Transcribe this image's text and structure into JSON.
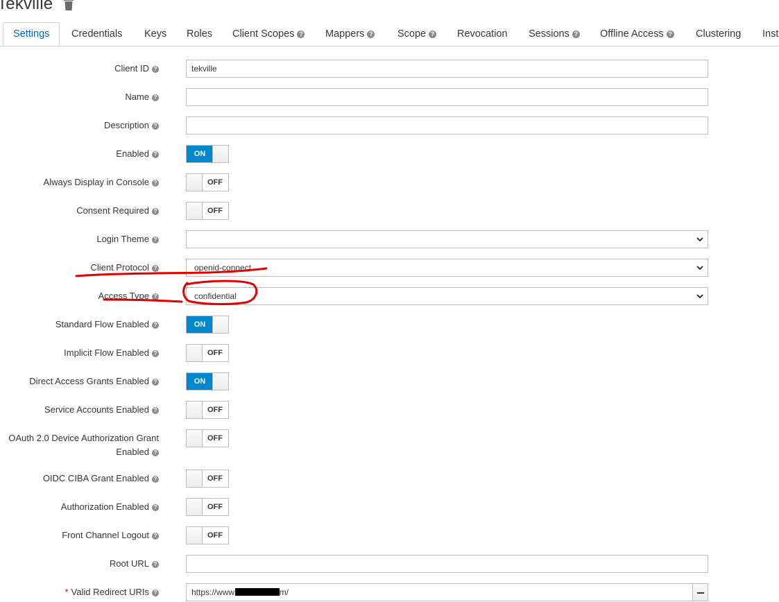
{
  "header": {
    "title": "Tekville",
    "delete_icon": "trash-icon"
  },
  "tabs": [
    {
      "label": "Settings",
      "help": false,
      "active": true
    },
    {
      "label": "Credentials",
      "help": false
    },
    {
      "label": "Keys",
      "help": false
    },
    {
      "label": "Roles",
      "help": false
    },
    {
      "label": "Client Scopes",
      "help": true
    },
    {
      "label": "Mappers",
      "help": true
    },
    {
      "label": "Scope",
      "help": true
    },
    {
      "label": "Revocation",
      "help": false
    },
    {
      "label": "Sessions",
      "help": true
    },
    {
      "label": "Offline Access",
      "help": true
    },
    {
      "label": "Clustering",
      "help": false
    },
    {
      "label": "Inst",
      "help": false
    }
  ],
  "form": {
    "client_id": {
      "label": "Client ID",
      "value": "tekville"
    },
    "name": {
      "label": "Name",
      "value": ""
    },
    "description": {
      "label": "Description",
      "value": ""
    },
    "enabled": {
      "label": "Enabled",
      "state": "ON"
    },
    "always_display": {
      "label": "Always Display in Console",
      "state": "OFF"
    },
    "consent_required": {
      "label": "Consent Required",
      "state": "OFF"
    },
    "login_theme": {
      "label": "Login Theme",
      "value": ""
    },
    "client_protocol": {
      "label": "Client Protocol",
      "value": "openid-connect"
    },
    "access_type": {
      "label": "Access Type",
      "value": "confidential"
    },
    "standard_flow": {
      "label": "Standard Flow Enabled",
      "state": "ON"
    },
    "implicit_flow": {
      "label": "Implicit Flow Enabled",
      "state": "OFF"
    },
    "direct_access": {
      "label": "Direct Access Grants Enabled",
      "state": "ON"
    },
    "service_accounts": {
      "label": "Service Accounts Enabled",
      "state": "OFF"
    },
    "oauth_device": {
      "label_line1": "OAuth 2.0 Device Authorization Grant",
      "label_line2": "Enabled",
      "state": "OFF"
    },
    "oidc_ciba": {
      "label": "OIDC CIBA Grant Enabled",
      "state": "OFF"
    },
    "authorization": {
      "label": "Authorization Enabled",
      "state": "OFF"
    },
    "front_channel_logout": {
      "label": "Front Channel Logout",
      "state": "OFF"
    },
    "root_url": {
      "label": "Root URL",
      "value": ""
    },
    "valid_redirect": {
      "label": "Valid Redirect URIs",
      "required_mark": "*",
      "value_prefix": "https://www.",
      "value_suffix": "m/"
    }
  },
  "toggle_text": {
    "on": "ON",
    "off": "OFF"
  },
  "colors": {
    "accent": "#0088ce",
    "active_tab": "#0066cc",
    "annotation": "#e00000"
  }
}
